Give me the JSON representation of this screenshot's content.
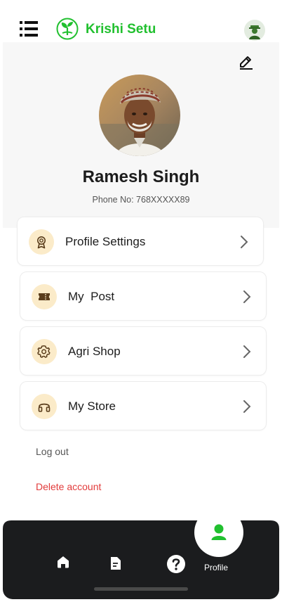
{
  "header": {
    "brand": "Krishi Setu",
    "brand_color": "#21c02f",
    "menu_icon": "list-menu-icon",
    "logo_icon": "sprout-logo-icon",
    "avatar_icon": "farmer-avatar-icon"
  },
  "profile": {
    "name": "Ramesh Singh",
    "phone_label": "Phone No:",
    "phone_value": "768XXXXX89",
    "edit_icon": "pencil-icon",
    "photo_icon": "profile-photo"
  },
  "menu": [
    {
      "label": "Profile Settings",
      "icon": "award-badge-icon"
    },
    {
      "label": "My  Post",
      "icon": "ticket-icon"
    },
    {
      "label": "Agri Shop",
      "icon": "gear-icon"
    },
    {
      "label": "My Store",
      "icon": "headphones-icon"
    }
  ],
  "account": {
    "logout": "Log out",
    "delete": "Delete account",
    "delete_color": "#e23b3b"
  },
  "bottom_nav": {
    "items": [
      {
        "name": "home",
        "icon": "home-icon"
      },
      {
        "name": "posts",
        "icon": "document-icon"
      },
      {
        "name": "help",
        "icon": "question-icon"
      }
    ],
    "active_label": "Profile",
    "active_icon": "person-icon",
    "active_color": "#21c02f",
    "bar_color": "#1b1c1e"
  }
}
